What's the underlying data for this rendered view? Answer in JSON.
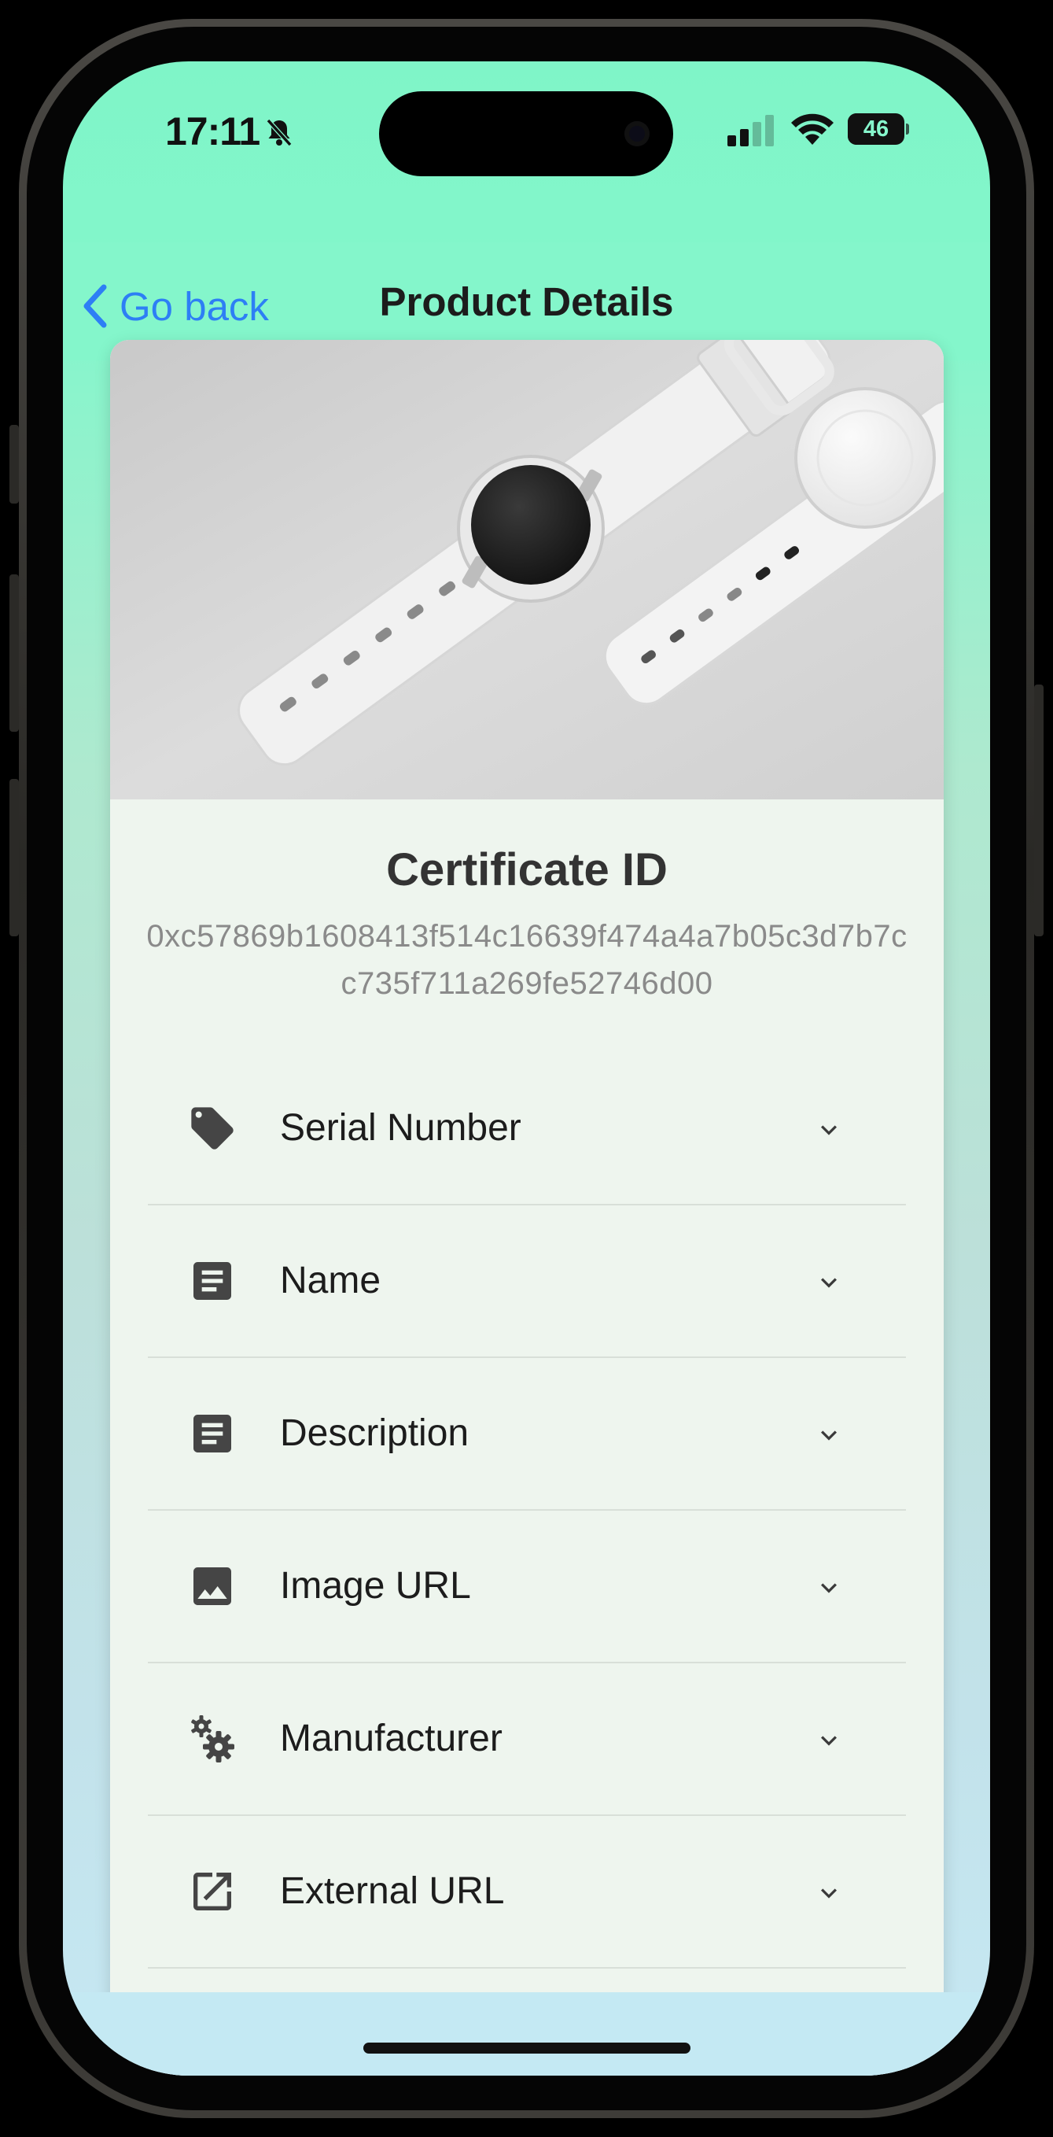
{
  "status_bar": {
    "time": "17:11",
    "battery": "46",
    "battery_level": 0.46
  },
  "nav": {
    "back_label": "Go back",
    "title": "Product Details"
  },
  "certificate": {
    "title": "Certificate ID",
    "id": "0xc57869b1608413f514c16639f474a4a7b05c3d7b7cc735f711a269fe52746d00"
  },
  "attributes": [
    {
      "label": "Serial Number",
      "icon": "tag-icon"
    },
    {
      "label": "Name",
      "icon": "article-icon"
    },
    {
      "label": "Description",
      "icon": "article-icon"
    },
    {
      "label": "Image URL",
      "icon": "image-icon"
    },
    {
      "label": "Manufacturer",
      "icon": "gears-icon"
    },
    {
      "label": "External URL",
      "icon": "open-in-new-icon"
    }
  ],
  "colors": {
    "accent": "#2d7ff5",
    "header_bg": "#84f6cb",
    "card_bg": "#eef5ee",
    "icon": "#454545"
  }
}
